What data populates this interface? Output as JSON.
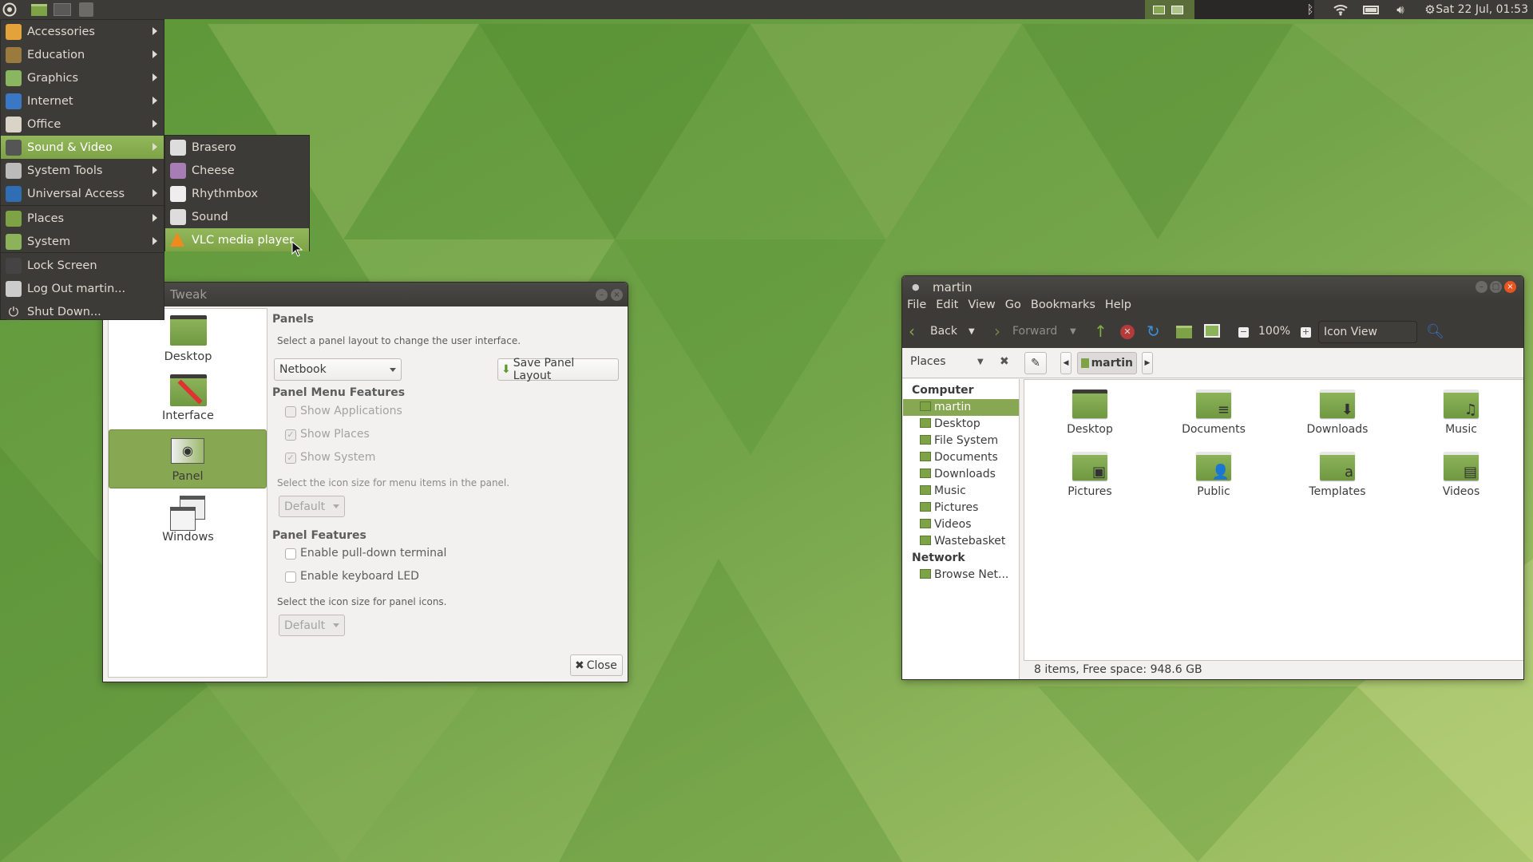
{
  "colors": {
    "accent": "#87a752",
    "panel": "#3c3b37",
    "window_bg": "#f2f1f0"
  },
  "top_panel": {
    "launchers": [
      "mate-logo-icon",
      "file-manager-icon",
      "terminal-icon",
      "apps-icon"
    ],
    "tray": [
      "bluetooth-icon",
      "wifi-icon",
      "battery-icon",
      "volume-icon",
      "settings-icon"
    ],
    "clock": "Sat 22 Jul, 01:53"
  },
  "menu": {
    "items": [
      {
        "label": "Accessories",
        "icon": "accessories-icon",
        "color": "#e4a23b",
        "submenu": true
      },
      {
        "label": "Education",
        "icon": "education-icon",
        "color": "#9b7a3e",
        "submenu": true
      },
      {
        "label": "Graphics",
        "icon": "graphics-icon",
        "color": "#8ab561",
        "submenu": true
      },
      {
        "label": "Internet",
        "icon": "globe-icon",
        "color": "#3a77c5",
        "submenu": true
      },
      {
        "label": "Office",
        "icon": "office-icon",
        "color": "#d9d3c8",
        "submenu": true
      },
      {
        "label": "Sound & Video",
        "icon": "multimedia-icon",
        "color": "#555",
        "submenu": true,
        "selected": true
      },
      {
        "label": "System Tools",
        "icon": "gear-icon",
        "color": "#bbb",
        "submenu": true
      },
      {
        "label": "Universal Access",
        "icon": "accessibility-icon",
        "color": "#2f6db5",
        "submenu": true
      },
      {
        "label": "Places",
        "icon": "folder-icon",
        "color": "#7ea346",
        "submenu": true
      },
      {
        "label": "System",
        "icon": "monitor-icon",
        "color": "#8db35a",
        "submenu": true
      },
      {
        "label": "Lock Screen",
        "icon": "lock-icon",
        "color": "#444"
      },
      {
        "label": "Log Out martin...",
        "icon": "logout-icon",
        "color": "#ccc"
      },
      {
        "label": "Shut Down...",
        "icon": "power-icon",
        "color": "#3c3b37"
      }
    ],
    "submenu": [
      {
        "label": "Brasero",
        "icon": "disc-icon",
        "color": "#ddd"
      },
      {
        "label": "Cheese",
        "icon": "cheese-icon",
        "color": "#a87db5"
      },
      {
        "label": "Rhythmbox",
        "icon": "rhythmbox-icon",
        "color": "#eee"
      },
      {
        "label": "Sound",
        "icon": "sound-icon",
        "color": "#ddd"
      },
      {
        "label": "VLC media player",
        "icon": "vlc-cone-icon",
        "color": "#f08a1c",
        "selected": true
      }
    ]
  },
  "tweak": {
    "title": "Tweak",
    "sidebar": [
      {
        "label": "Desktop"
      },
      {
        "label": "Interface"
      },
      {
        "label": "Panel",
        "selected": true
      },
      {
        "label": "Windows"
      }
    ],
    "panels_header": "Panels",
    "panels_desc": "Select a panel layout to change the user interface.",
    "layout_value": "Netbook",
    "save_label": "Save Panel Layout",
    "menu_features_header": "Panel Menu Features",
    "menu_features": [
      {
        "label": "Show Applications",
        "checked": false
      },
      {
        "label": "Show Places",
        "checked": true
      },
      {
        "label": "Show System",
        "checked": true
      }
    ],
    "menu_icon_desc": "Select the icon size for menu items in the panel.",
    "menu_icon_value": "Default",
    "panel_features_header": "Panel Features",
    "panel_features": [
      {
        "label": "Enable pull-down terminal",
        "checked": false
      },
      {
        "label": "Enable keyboard LED",
        "checked": false
      }
    ],
    "panel_icon_desc": "Select the icon size for panel icons.",
    "panel_icon_value": "Default",
    "close_label": "Close"
  },
  "files": {
    "title": "martin",
    "menubar": [
      "File",
      "Edit",
      "View",
      "Go",
      "Bookmarks",
      "Help"
    ],
    "back": "Back",
    "forward": "Forward",
    "zoom": "100%",
    "view_mode": "Icon View",
    "sidebar_mode": "Places",
    "path": "martin",
    "places": {
      "computer_header": "Computer",
      "computer": [
        {
          "label": "martin",
          "selected": true
        },
        {
          "label": "Desktop"
        },
        {
          "label": "File System"
        },
        {
          "label": "Documents"
        },
        {
          "label": "Downloads"
        },
        {
          "label": "Music"
        },
        {
          "label": "Pictures"
        },
        {
          "label": "Videos"
        },
        {
          "label": "Wastebasket"
        }
      ],
      "network_header": "Network",
      "network": [
        {
          "label": "Browse Net..."
        }
      ]
    },
    "items": [
      {
        "label": "Desktop",
        "icon": "desktop-folder-icon",
        "emblem": ""
      },
      {
        "label": "Documents",
        "icon": "documents-folder-icon",
        "emblem": "≡"
      },
      {
        "label": "Downloads",
        "icon": "downloads-folder-icon",
        "emblem": "⬇"
      },
      {
        "label": "Music",
        "icon": "music-folder-icon",
        "emblem": "♫"
      },
      {
        "label": "Pictures",
        "icon": "pictures-folder-icon",
        "emblem": "▣"
      },
      {
        "label": "Public",
        "icon": "public-folder-icon",
        "emblem": "👤"
      },
      {
        "label": "Templates",
        "icon": "templates-folder-icon",
        "emblem": "a"
      },
      {
        "label": "Videos",
        "icon": "videos-folder-icon",
        "emblem": "▤"
      }
    ],
    "status": "8 items, Free space: 948.6 GB"
  }
}
